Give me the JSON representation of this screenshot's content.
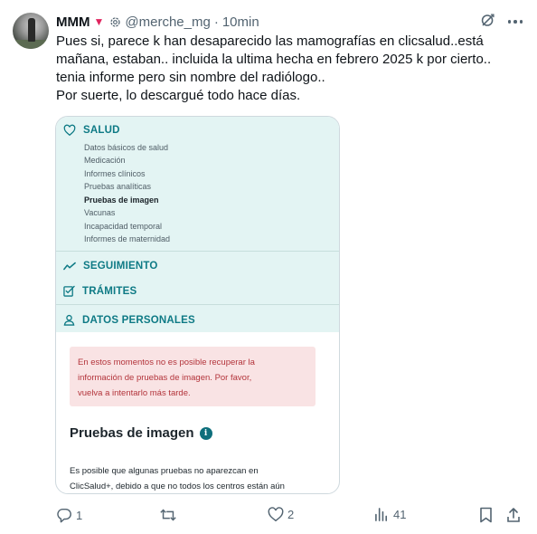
{
  "tweet": {
    "name": "MMM",
    "handle": "@merche_mg",
    "separator": "·",
    "time": "10min",
    "text_lines": [
      "Pues si, parece k han desaparecido las mamografías en clicsalud..está",
      "mañana, estaban..  incluida la ultima hecha en febrero 2025 k por cierto..",
      "tenia informe pero sin nombre del radiólogo..",
      "Por suerte, lo descargué todo hace días."
    ]
  },
  "card": {
    "salud": {
      "label": "SALUD",
      "items": [
        "Datos básicos de salud",
        "Medicación",
        "Informes clínicos",
        "Pruebas analíticas",
        "Pruebas de imagen",
        "Vacunas",
        "Incapacidad temporal",
        "Informes de maternidad"
      ],
      "selected_index": 4
    },
    "seguimiento": "SEGUIMIENTO",
    "tramites": "TRÁMITES",
    "datos_personales": "DATOS PERSONALES",
    "error_lines": [
      "En estos momentos no es posible recuperar la",
      "información de pruebas de imagen. Por favor,",
      "vuelva a intentarlo más tarde."
    ],
    "heading": "Pruebas de imagen",
    "info_glyph": "i",
    "paragraph_lines": [
      "Es posible que algunas pruebas no aparezcan en",
      "ClicSalud+, debido a que no todos los centros están aún"
    ]
  },
  "actions": {
    "replies": "1",
    "retweets": "",
    "likes": "2",
    "views": "41"
  },
  "colors": {
    "teal": "#0e7a85",
    "panel_bg": "#e3f4f3",
    "error_bg": "#f9e3e4",
    "error_text": "#b3343b",
    "muted": "#536471",
    "heart": "#e0245e"
  },
  "icons": {
    "header": [
      "heart-icon",
      "gear-badge-icon",
      "grok-icon",
      "more-icon"
    ],
    "card": [
      "heart-outline-icon",
      "trend-line-icon",
      "checklist-icon",
      "person-icon",
      "info-icon"
    ],
    "actions": [
      "reply-icon",
      "retweet-icon",
      "like-icon",
      "views-icon",
      "bookmark-icon",
      "share-icon"
    ]
  }
}
